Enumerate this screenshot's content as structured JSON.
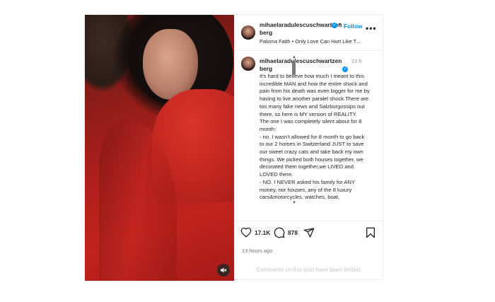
{
  "header": {
    "username": "mihaelaradulescuschwartzenberg",
    "dot": "•",
    "follow_label": "Follow",
    "more_icon": "more-horizontal-icon",
    "audio": "Paloma Faith • Only Love Can Hurt Like T..."
  },
  "caption": {
    "username": "mihaelaradulescuschwartzenberg",
    "time": "13 h",
    "text": "It's hard to believe how much I meant to this incredible MAN and how the entire shock and pain from his death was even bigger for me by having to live another paralel shock.There are too many fake news and Salzburgossips out there. so here is MY version of REALITY.\nThe one I was completely silent about for 8 month:\n- no. I wasn't allowed for 8 month to go back to our 2 homes in Switzerland JUST to save our sweet crazy cats and take back my own things. We picked both houses together, we decorated them together,we LIVED and LOVED there.\n- NO. I NEVER asked his family for ANY money, nor houses, any of the 8 luxury cars&motorcycles, watches, boat,"
  },
  "actions": {
    "like_count": "17.1K",
    "comment_count": "878",
    "time_ago": "13 hours ago"
  },
  "footer": {
    "comments_limited": "Comments on this post have been limited."
  },
  "colors": {
    "accent": "#0095f6",
    "text": "#262626",
    "muted": "#737373"
  }
}
